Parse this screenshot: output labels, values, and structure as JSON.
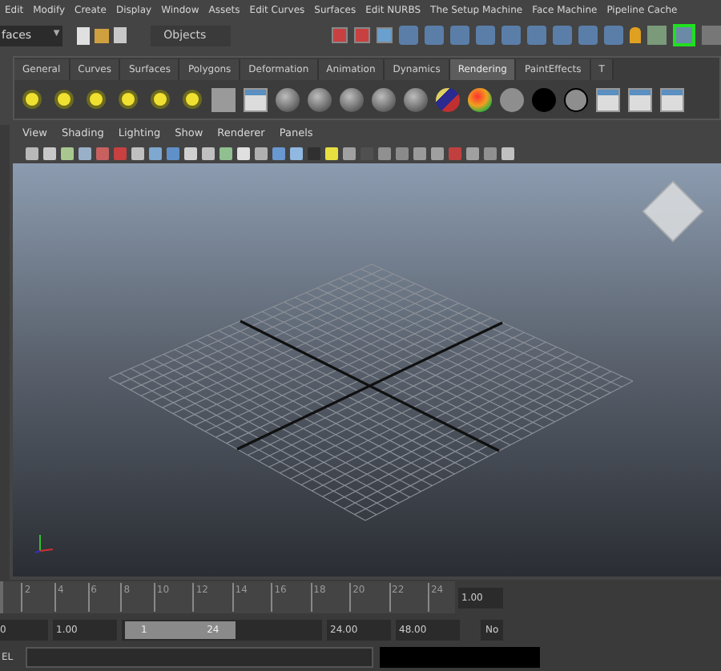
{
  "menu_bar": [
    "Edit",
    "Modify",
    "Create",
    "Display",
    "Window",
    "Assets",
    "Edit Curves",
    "Surfaces",
    "Edit NURBS",
    "The Setup Machine",
    "Face Machine",
    "Pipeline Cache"
  ],
  "status_line": {
    "mode_dropdown": "faces",
    "dropdown_arrow": "▼",
    "selection_field": "Objects"
  },
  "shelf_tabs": [
    {
      "label": "General",
      "selected": false
    },
    {
      "label": "Curves",
      "selected": false
    },
    {
      "label": "Surfaces",
      "selected": false
    },
    {
      "label": "Polygons",
      "selected": false
    },
    {
      "label": "Deformation",
      "selected": false
    },
    {
      "label": "Animation",
      "selected": false
    },
    {
      "label": "Dynamics",
      "selected": false
    },
    {
      "label": "Rendering",
      "selected": true
    },
    {
      "label": "PaintEffects",
      "selected": false
    },
    {
      "label": "T",
      "selected": false
    }
  ],
  "panel_menu": [
    "View",
    "Shading",
    "Lighting",
    "Show",
    "Renderer",
    "Panels"
  ],
  "time_slider": {
    "ticks": [
      "2",
      "4",
      "6",
      "8",
      "10",
      "12",
      "14",
      "16",
      "18",
      "20",
      "22",
      "24"
    ],
    "current_frame": "1.00",
    "level": 0
  },
  "range_slider": {
    "start_time": "0",
    "playback_start": "1.00",
    "range_start": "1",
    "range_end": "24",
    "playback_end": "24.00",
    "end_time": "48.00",
    "option": "No",
    "level": 0.55
  },
  "command_line": {
    "label": "EL"
  }
}
